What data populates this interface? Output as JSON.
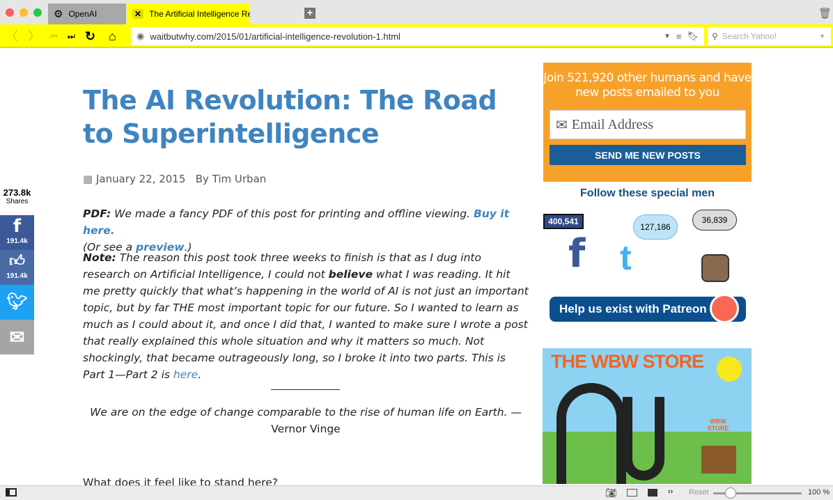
{
  "browser": {
    "tabs": [
      {
        "label": "OpenAI",
        "icon": "openai-icon"
      },
      {
        "label": "The Artificial Intelligence Revo",
        "icon": "close-icon",
        "active": true
      }
    ],
    "url": "waitbutwhy.com/2015/01/artificial-intelligence-revolution-1.html",
    "search_placeholder": "Search Yahoo!",
    "accent": "#ffff00"
  },
  "article": {
    "title": "The AI Revolution: The Road to Superintelligence",
    "date": "January 22, 2015",
    "author": "By Tim Urban",
    "pdf_label": "PDF:",
    "pdf_text": " We made a fancy PDF of this post for printing and offline viewing. ",
    "pdf_link": "Buy it here.",
    "preview_pre": "(Or see a ",
    "preview_link": "preview",
    "preview_post": ".)",
    "note_label": "Note:",
    "note_1": " The reason this post took three weeks to finish is that as I dug into research on Artificial Intelligence, I could not ",
    "note_bold": "believe",
    "note_2": " what I was reading. It hit me pretty quickly that what’s happening in the world of AI is not just an important topic, but by far THE most important topic for our future. So I wanted to learn as much as I could about it, and once I did that, I wanted to make sure I wrote a post that really explained this whole situation and why it matters so much. Not shockingly, that became outrageously long, so I broke it into two parts. This is Part 1—Part 2 is ",
    "note_link": "here",
    "note_end": ".",
    "quote": "We are on the edge of change comparable to the rise of human life on Earth. —",
    "quote_author": "Vernor Vinge",
    "next_line": "What does it feel like to stand here?"
  },
  "share": {
    "total": "273.8k",
    "total_label": "Shares",
    "facebook": "191.4k",
    "like": "191.4k"
  },
  "sidebar": {
    "signup_text": "Join 521,920 other humans and have new posts emailed to you",
    "email_placeholder": "Email Address",
    "send_button": "SEND ME NEW POSTS",
    "follow_title": "Follow these special men",
    "facebook_count": "400,541",
    "twitter_count": "127,186",
    "instagram_count": "36,839",
    "patreon_button": "Help us exist with Patreon",
    "store_title": "THE WBW STORE",
    "store_sign": "WBW STORE"
  },
  "statusbar": {
    "reset": "Reset",
    "zoom": "100 %",
    "zoom_value": 100
  }
}
